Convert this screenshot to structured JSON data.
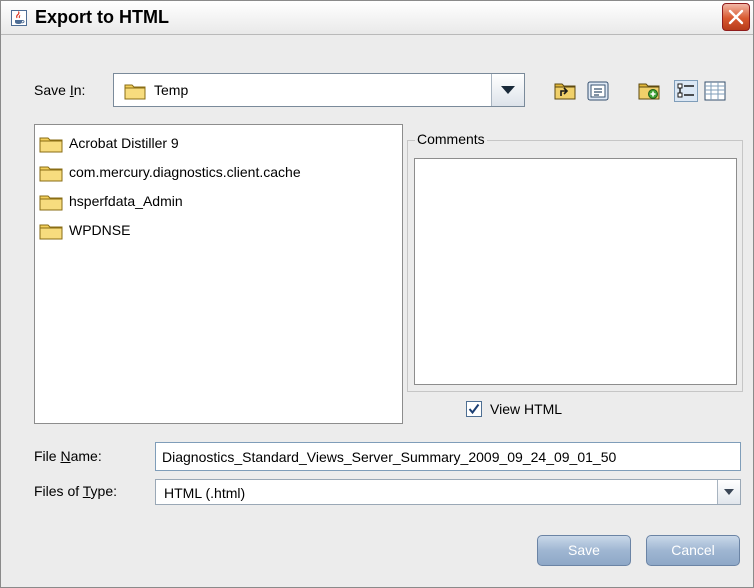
{
  "window": {
    "title": "Export to HTML",
    "icon": "java-cup-icon",
    "close_icon": "close-icon"
  },
  "save_in": {
    "label_pre": "Save ",
    "label_mnemonic": "I",
    "label_post": "n:",
    "value": "Temp",
    "icon": "folder-icon"
  },
  "toolbar": {
    "buttons": [
      "up-one-level-icon",
      "home-icon",
      "new-folder-icon",
      "list-view-icon",
      "details-view-icon"
    ],
    "active": "list-view-icon"
  },
  "file_list": {
    "items": [
      {
        "name": "Acrobat Distiller 9",
        "icon": "folder-icon"
      },
      {
        "name": "com.mercury.diagnostics.client.cache",
        "icon": "folder-icon"
      },
      {
        "name": "hsperfdata_Admin",
        "icon": "folder-icon"
      },
      {
        "name": "WPDNSE",
        "icon": "folder-icon"
      }
    ]
  },
  "comments": {
    "label": "Comments",
    "value": ""
  },
  "view_html": {
    "label": "View HTML",
    "checked": true
  },
  "file_name": {
    "label_pre": "File ",
    "label_mnemonic": "N",
    "label_post": "ame:",
    "value": "Diagnostics_Standard_Views_Server_Summary_2009_09_24_09_01_50"
  },
  "file_type": {
    "label_pre": "Files of ",
    "label_mnemonic": "T",
    "label_post": "ype:",
    "value": "HTML (.html)"
  },
  "buttons": {
    "save": "Save",
    "cancel": "Cancel"
  },
  "colors": {
    "close_button": "#d8582f",
    "button_fill": "#9fb6d2",
    "folder": "#f3cf5b"
  }
}
